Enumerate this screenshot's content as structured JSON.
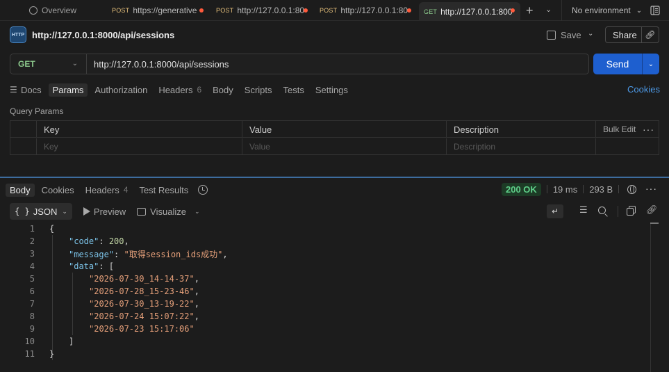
{
  "tabbar": {
    "overview": "Overview",
    "tabs": [
      {
        "method": "POST",
        "label": "https://generative"
      },
      {
        "method": "POST",
        "label": "http://127.0.0.1:80"
      },
      {
        "method": "POST",
        "label": "http://127.0.0.1:80"
      },
      {
        "method": "GET",
        "label": "http://127.0.0.1:800"
      }
    ],
    "environment": "No environment"
  },
  "request": {
    "badge": "HTTP",
    "title": "http://127.0.0.1:8000/api/sessions",
    "save_label": "Save",
    "share_label": "Share",
    "method": "GET",
    "url": "http://127.0.0.1:8000/api/sessions",
    "send_label": "Send",
    "tabs": {
      "docs": "Docs",
      "params": "Params",
      "authorization": "Authorization",
      "headers": "Headers",
      "headers_count": "6",
      "body": "Body",
      "scripts": "Scripts",
      "tests": "Tests",
      "settings": "Settings"
    },
    "cookies_link": "Cookies",
    "query_params_label": "Query Params",
    "table": {
      "headers": [
        "Key",
        "Value",
        "Description"
      ],
      "bulk_edit": "Bulk Edit",
      "placeholders": [
        "Key",
        "Value",
        "Description"
      ]
    }
  },
  "response": {
    "tabs": {
      "body": "Body",
      "cookies": "Cookies",
      "headers": "Headers",
      "headers_count": "4",
      "test_results": "Test Results"
    },
    "status": "200 OK",
    "time": "19 ms",
    "size": "293 B",
    "format": "JSON",
    "preview_label": "Preview",
    "visualize_label": "Visualize",
    "line_numbers": [
      "1",
      "2",
      "3",
      "4",
      "5",
      "6",
      "7",
      "8",
      "9",
      "10",
      "11"
    ],
    "json": {
      "open": "{",
      "code_key": "\"code\"",
      "code_val": "200",
      "message_key": "\"message\"",
      "message_val": "\"取得session_ids成功\"",
      "data_key": "\"data\"",
      "data_items": [
        "\"2026-07-30_14-14-37\"",
        "\"2026-07-28_15-23-46\"",
        "\"2026-07-30_13-19-22\"",
        "\"2026-07-24 15:07:22\"",
        "\"2026-07-23 15:17:06\""
      ],
      "close_bracket": "]",
      "close": "}"
    }
  },
  "colors": {
    "send": "#1e5fcf",
    "get": "#8cc98c",
    "post": "#e6c07b",
    "status_ok": "#5fd08a",
    "link": "#4d9ae8"
  }
}
